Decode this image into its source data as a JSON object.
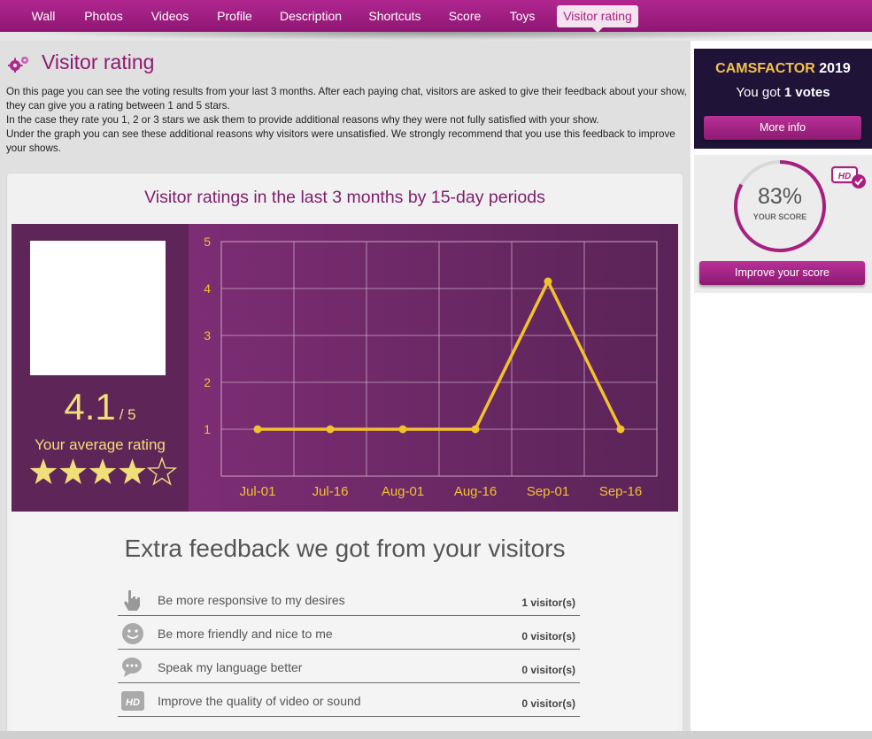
{
  "nav": {
    "tabs": [
      {
        "label": "Wall"
      },
      {
        "label": "Photos"
      },
      {
        "label": "Videos"
      },
      {
        "label": "Profile"
      },
      {
        "label": "Description"
      },
      {
        "label": "Shortcuts"
      },
      {
        "label": "Score"
      },
      {
        "label": "Toys"
      },
      {
        "label": "Visitor rating",
        "active": true
      }
    ]
  },
  "page": {
    "title": "Visitor rating",
    "intro": [
      "On this page you can see the voting results from your last 3 months. After each paying chat, visitors are asked to give their feedback about your show, they can give you a rating between 1 and 5 stars.",
      "In the case they rate you 1, 2 or 3 stars we ask them to provide additional reasons why they were not fully satisfied with your show.",
      "Under the graph you can see these additional reasons why visitors were unsatisfied. We strongly recommend that you use this feedback to improve your shows."
    ]
  },
  "rating": {
    "panel_title": "Visitor ratings in the last 3 months by 15-day periods",
    "average": "4.1",
    "out_of": "/ 5",
    "average_label": "Your average rating",
    "stars_filled": 4,
    "stars_total": 5,
    "star_color": "#f0de78"
  },
  "chart_data": {
    "type": "line",
    "categories": [
      "Jul-01",
      "Jul-16",
      "Aug-01",
      "Aug-16",
      "Sep-01",
      "Sep-16"
    ],
    "values": [
      1,
      1,
      1,
      1,
      4.15,
      1
    ],
    "y_ticks": [
      "1",
      "2",
      "3",
      "4",
      "5"
    ],
    "ylim": [
      0,
      5
    ],
    "grid": true,
    "line_color": "#f2c22e"
  },
  "feedback": {
    "title": "Extra feedback we got from your visitors",
    "items": [
      {
        "icon": "hand-pointer-icon",
        "label": "Be more responsive to my desires",
        "count": "1 visitor(s)"
      },
      {
        "icon": "smiley-icon",
        "label": "Be more friendly and nice to me",
        "count": "0 visitor(s)"
      },
      {
        "icon": "chat-bubble-icon",
        "label": "Speak my language better",
        "count": "0 visitor(s)"
      },
      {
        "icon": "hd-icon",
        "label": "Improve the quality of video or sound",
        "count": "0 visitor(s)"
      }
    ]
  },
  "camsfactor": {
    "brand": "CAMSFACTOR",
    "year": "2019",
    "votes_prefix": "You got",
    "votes_count": "1 votes",
    "button": "More info"
  },
  "score": {
    "percent": "83%",
    "value": 0.83,
    "label": "YOUR SCORE",
    "hd_badge": "HD",
    "button": "Improve your score"
  }
}
